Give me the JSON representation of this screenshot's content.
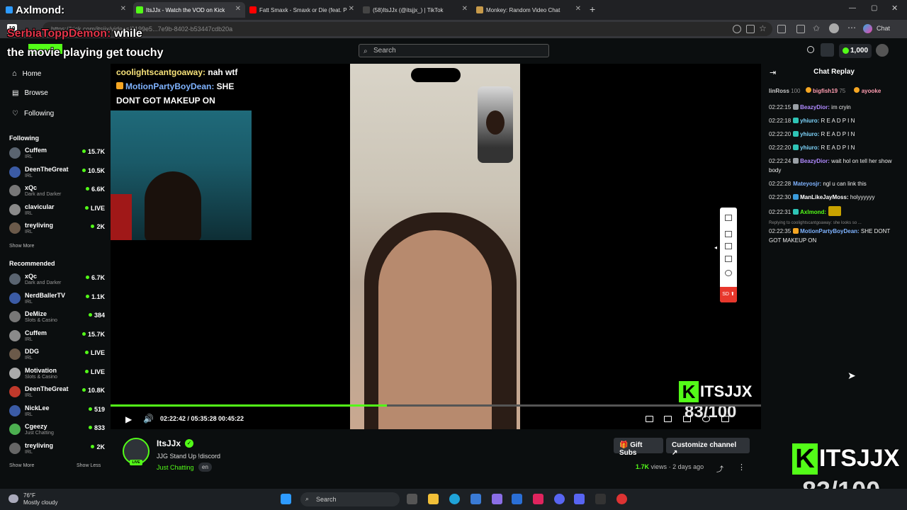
{
  "browser": {
    "tabs": [
      {
        "label": "Axlmond:",
        "color": "#f5a623"
      },
      {
        "label": "ItsJJx - Watch the VOD on Kick",
        "color": "#53fc18"
      },
      {
        "label": "Fatt Smaxk - Smaxk or Die (feat. P",
        "color": "#ff0000"
      },
      {
        "label": "(58)ItsJJx (@itsjjx_) | TikTok",
        "color": "#111111"
      },
      {
        "label": "Monkey: Random Video Chat",
        "color": "#c79a4a"
      }
    ],
    "url": "https://kick.com/itsjjx/videos/0199e5...7e9b-8402-b53447cdb20a",
    "tab_count": "19",
    "copilot_label": "Chat"
  },
  "header": {
    "search_placeholder": "Search",
    "coins": "1,000"
  },
  "overlay_chat": {
    "user": "SerbiaToppDemon:",
    "text_line1": " while",
    "text_line2": "the movie playing get touchy"
  },
  "sidebar": {
    "nav": [
      {
        "label": "Home",
        "icon": "home-icon"
      },
      {
        "label": "Browse",
        "icon": "browse-icon"
      },
      {
        "label": "Following",
        "icon": "heart-icon"
      }
    ],
    "following_title": "Following",
    "following": [
      {
        "name": "Cuffem",
        "category": "IRL",
        "viewers": "15.7K"
      },
      {
        "name": "DeenTheGreat",
        "category": "IRL",
        "viewers": "10.5K"
      },
      {
        "name": "xQc",
        "category": "Dark and Darker",
        "viewers": "6.6K"
      },
      {
        "name": "clavicular",
        "category": "IRL",
        "viewers": "LIVE"
      },
      {
        "name": "treyliving",
        "category": "IRL",
        "viewers": "2K"
      }
    ],
    "show_more_1": "Show More",
    "recommended_title": "Recommended",
    "recommended": [
      {
        "name": "xQc",
        "category": "Dark and Darker",
        "viewers": "6.7K"
      },
      {
        "name": "NerdBallerTV",
        "category": "IRL",
        "viewers": "1.1K"
      },
      {
        "name": "DeMize",
        "category": "Slots & Casino",
        "viewers": "384"
      },
      {
        "name": "Cuffem",
        "category": "IRL",
        "viewers": "15.7K"
      },
      {
        "name": "DDG",
        "category": "IRL",
        "viewers": "LIVE"
      },
      {
        "name": "Motivation",
        "category": "Slots & Casino",
        "viewers": "LIVE"
      },
      {
        "name": "DeenTheGreat",
        "category": "IRL",
        "viewers": "10.8K"
      },
      {
        "name": "NickLee",
        "category": "IRL",
        "viewers": "519"
      },
      {
        "name": "Cgeezy",
        "category": "Just Chatting",
        "viewers": "833"
      },
      {
        "name": "treyliving",
        "category": "IRL",
        "viewers": "2K"
      }
    ],
    "show_more_2": "Show More",
    "show_less": "Show Less"
  },
  "player": {
    "chat_overlay": [
      {
        "user": "coolightscantgoaway:",
        "text": " nah wtf",
        "color": "#f7e27a"
      },
      {
        "user": "MotionPartyBoyDean:",
        "text": " SHE",
        "color": "#7fb3ff"
      },
      {
        "user": "",
        "text": "DONT GOT MAKEUP ON",
        "color": "#ffffff"
      }
    ],
    "time_current": "02:22:42",
    "time_total": "05:35:28",
    "time_remaining": "00:45:22",
    "time_sep": " / ",
    "progress": 0.425,
    "sd_label": "SD",
    "watermark_name": "ITSJJX",
    "watermark_score": "83/100"
  },
  "stream": {
    "name": "ItsJJx",
    "title": "JJG Stand Up !discord",
    "category": "Just Chatting",
    "language": "en",
    "live_badge": "LIVE",
    "gift_subs": "Gift Subs",
    "customize": "Customize channel",
    "views_count": "1.7K",
    "views_label": "views",
    "ago": "2 days ago"
  },
  "chat": {
    "title": "Chat Replay",
    "gifters": [
      {
        "name": "linRoss",
        "count": "100",
        "color": "#cccccc"
      },
      {
        "name": "bigfish19",
        "count": "75",
        "color": "#ff9db0"
      },
      {
        "name": "ayooke",
        "count": "",
        "color": "#ff9db0"
      }
    ],
    "messages": [
      {
        "ts": "02:22:15",
        "user": "BeazyDior:",
        "text": " im cryin",
        "color": "#b08aff",
        "badge": "#9aa0a6"
      },
      {
        "ts": "02:22:18",
        "user": "yhiuro:",
        "text": " R E A D P I N",
        "color": "#7fd7ff",
        "badge": "#2ec4b6"
      },
      {
        "ts": "02:22:20",
        "user": "yhiuro:",
        "text": " R E A D P I N",
        "color": "#7fd7ff",
        "badge": "#2ec4b6"
      },
      {
        "ts": "02:22:20",
        "user": "yhiuro:",
        "text": " R E A D P I N",
        "color": "#7fd7ff",
        "badge": "#2ec4b6"
      },
      {
        "ts": "02:22:24",
        "user": "BeazyDior:",
        "text": " wait hol on tell her show body",
        "color": "#b08aff",
        "badge": "#9aa0a6"
      },
      {
        "ts": "02:22:28",
        "user": "Mateyosjr:",
        "text": " ngl u can link this",
        "color": "#7fb3ff",
        "badge": ""
      },
      {
        "ts": "02:22:30",
        "user": "ManLikeJayMoss:",
        "text": " holyyyyyy",
        "color": "#ffffff",
        "badge": "#3a9bdc"
      },
      {
        "ts": "02:22:31",
        "user": "Axlmond:",
        "text": "",
        "color": "#53fc18",
        "badge": "#2ec4b6"
      },
      {
        "ts": "",
        "user": "",
        "text": "Replying to coolightscantgoaway: she looks so ...",
        "color": "#888888",
        "badge": ""
      },
      {
        "ts": "02:22:35",
        "user": "MotionPartyBoyDean:",
        "text": " SHE DONT GOT MAKEUP ON",
        "color": "#7fb3ff",
        "badge": "#f5a623"
      }
    ]
  },
  "overlay_top": {
    "axlmond": "Axlmond:"
  },
  "taskbar": {
    "temp": "76°F",
    "weather": "Mostly cloudy",
    "search": "Search"
  }
}
